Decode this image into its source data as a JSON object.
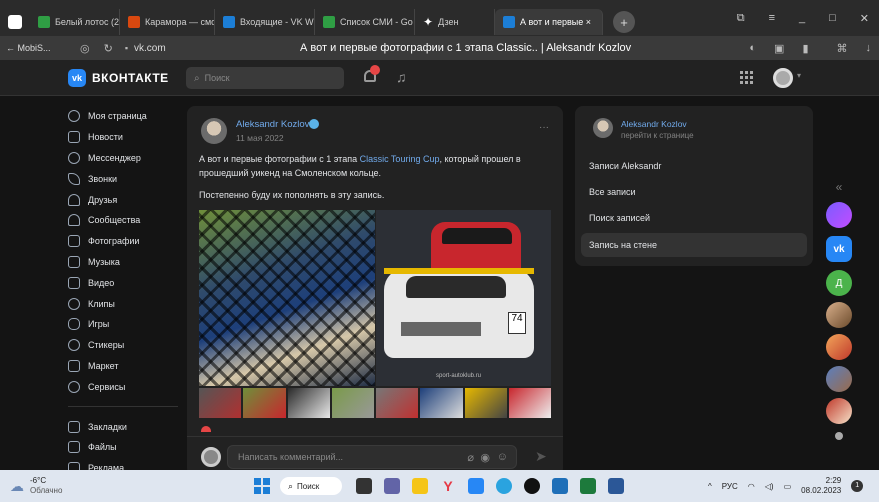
{
  "browser": {
    "tabs": [
      {
        "label": "Белый лотос (202",
        "color": "#2f9e44"
      },
      {
        "label": "Карамора — смо",
        "color": "#d9480f"
      },
      {
        "label": "Входящие - VK W",
        "color": "#1c7ed6"
      },
      {
        "label": "Список СМИ - Go",
        "color": "#2f9e44"
      },
      {
        "label": "Дзен",
        "color": "#111111"
      },
      {
        "label": "А вот и первые ×",
        "color": "#1c7ed6"
      }
    ],
    "back_label": "← MobiS...",
    "url": "vk.com",
    "page_title": "А вот и первые фотографии с 1 этапа Classic.. | Aleksandr Kozlov"
  },
  "vk": {
    "logo_text": "ВКОНТАКТЕ",
    "search_placeholder": "Поиск",
    "notification_count": "",
    "accent": "#2787f5"
  },
  "nav": {
    "items": [
      "Моя страница",
      "Новости",
      "Мессенджер",
      "Звонки",
      "Друзья",
      "Сообщества",
      "Фотографии",
      "Музыка",
      "Видео",
      "Клипы",
      "Игры",
      "Стикеры",
      "Маркет",
      "Сервисы"
    ],
    "bottom_items": [
      "Закладки",
      "Файлы",
      "Реклама"
    ]
  },
  "post": {
    "author": "Aleksandr Kozlov",
    "date": "11 мая 2022",
    "menu": "···",
    "text_before_link": "А вот и первые фотографии с 1 этапа ",
    "link": "Classic Touring Cup",
    "text_after_link": ", который прошел в прошедший уикенд на Смоленском кольце.",
    "text2": "Постепенно буду их пополнять в эту запись.",
    "comment_placeholder": "Написать комментарий...",
    "photo_watermark": "sport-autoklub.ru"
  },
  "side": {
    "author": "Aleksandr Kozlov",
    "subtitle": "перейти к странице",
    "items": [
      "Записи Aleksandr",
      "Все записи",
      "Поиск записей",
      "Запись на стене"
    ]
  },
  "rail": {
    "collapse": "«",
    "green_letter": "Д"
  },
  "taskbar": {
    "temp": "-6°C",
    "weather": "Облачно",
    "search": "Поиск",
    "lang": "РУС",
    "time": "2:29",
    "date": "08.02.2023"
  }
}
